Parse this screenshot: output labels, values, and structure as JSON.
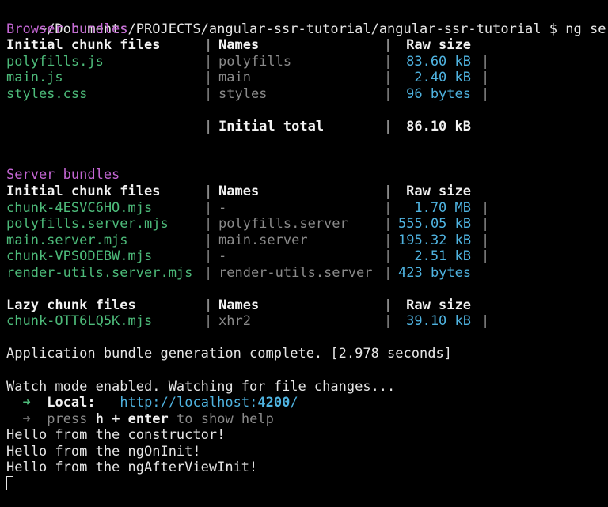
{
  "prompt": {
    "path": "~/Documents/PROJECTS/angular-ssr-tutorial/angular-ssr-tutorial",
    "symbol": "$",
    "command": "ng serve"
  },
  "browser": {
    "section_title": "Browser bundles",
    "headers": [
      "Initial chunk files",
      "Names",
      "Raw size"
    ],
    "rows": [
      {
        "file": "polyfills.js",
        "name": "polyfills",
        "size": "83.60 kB"
      },
      {
        "file": "main.js",
        "name": "main",
        "size": "2.40 kB"
      },
      {
        "file": "styles.css",
        "name": "styles",
        "size": "96 bytes"
      }
    ],
    "total_label": "Initial total",
    "total_value": "86.10 kB"
  },
  "server": {
    "section_title": "Server bundles",
    "headers": [
      "Initial chunk files",
      "Names",
      "Raw size"
    ],
    "rows": [
      {
        "file": "chunk-4ESVC6HO.mjs",
        "name": "-",
        "size": "1.70 MB"
      },
      {
        "file": "polyfills.server.mjs",
        "name": "polyfills.server",
        "size": "555.05 kB"
      },
      {
        "file": "main.server.mjs",
        "name": "main.server",
        "size": "195.32 kB"
      },
      {
        "file": "chunk-VPSODEBW.mjs",
        "name": "-",
        "size": "2.51 kB"
      },
      {
        "file": "render-utils.server.mjs",
        "name": "render-utils.server",
        "size": "423 bytes"
      }
    ]
  },
  "lazy": {
    "headers": [
      "Lazy chunk files",
      "Names",
      "Raw size"
    ],
    "rows": [
      {
        "file": "chunk-OTT6LQ5K.mjs",
        "name": "xhr2",
        "size": "39.10 kB"
      }
    ]
  },
  "generation_message": "Application bundle generation complete. [2.978 seconds]",
  "watch_message": "Watch mode enabled. Watching for file changes...",
  "local": {
    "arrow": "➜",
    "label": "Local:",
    "url_prefix": "http://localhost:",
    "port": "4200",
    "url_suffix": "/"
  },
  "help": {
    "arrow": "➜",
    "press": "press",
    "keys": "h + enter",
    "rest": "to show help"
  },
  "logs": [
    "Hello from the constructor!",
    "Hello from the ngOnInit!",
    "Hello from the ngAfterViewInit!"
  ],
  "separator": "|",
  "colors": {
    "background": "#000000",
    "text": "#e6e6e6",
    "section": "#c466d4",
    "file": "#4dbb7a",
    "name": "#8a8a8a",
    "size": "#4fb3e0"
  }
}
